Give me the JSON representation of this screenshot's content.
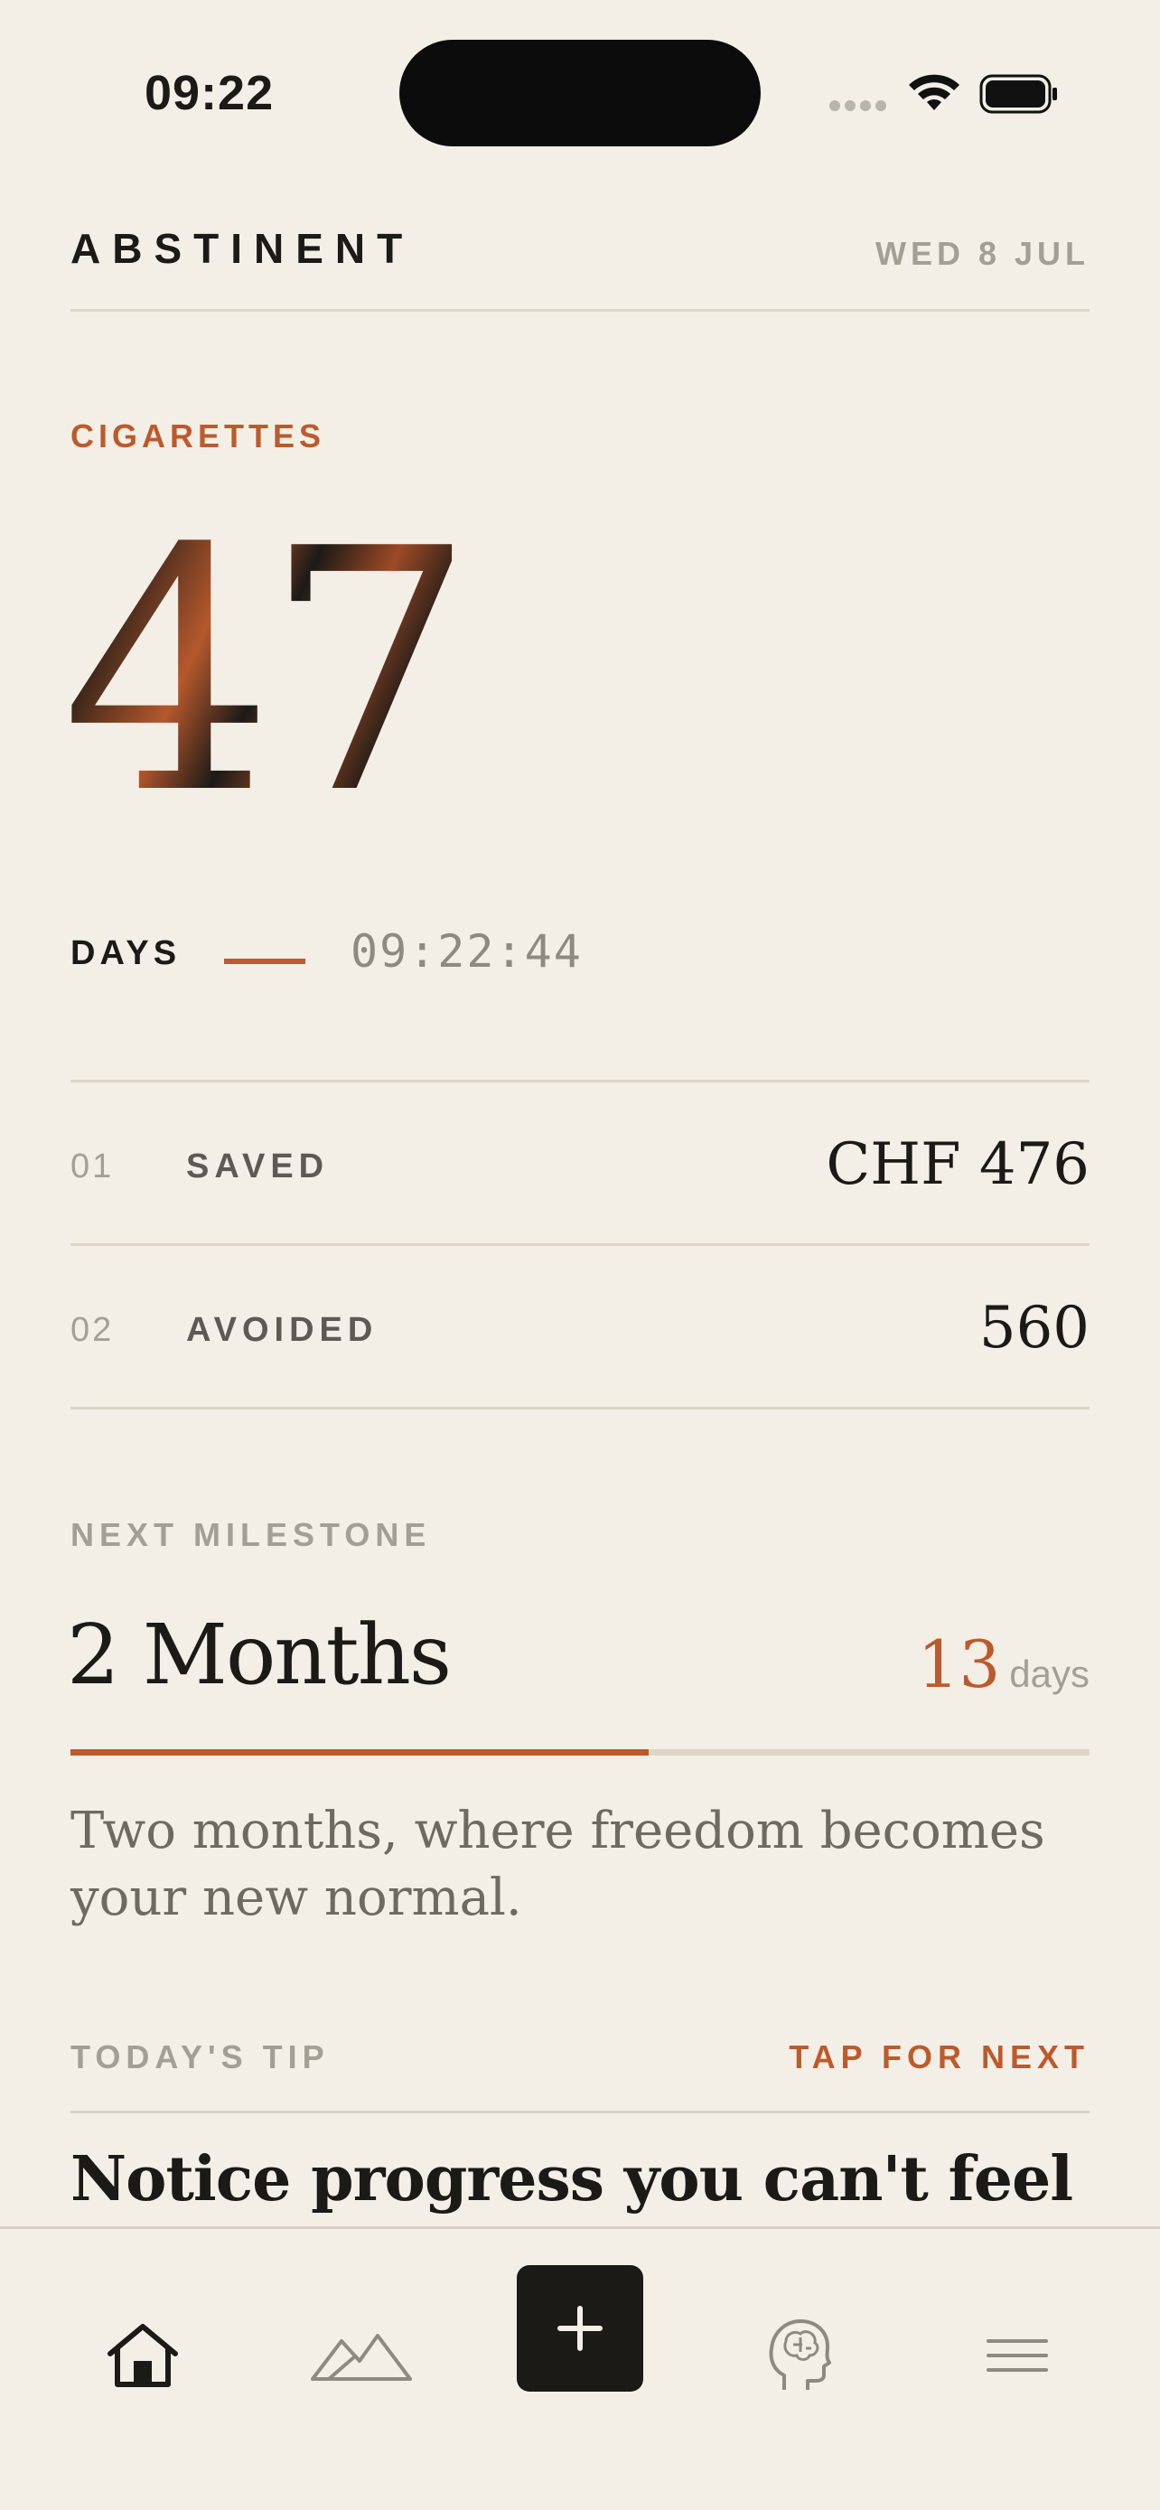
{
  "status_bar": {
    "time": "09:22"
  },
  "header": {
    "app_title": "ABSTINENT",
    "date": "WED 8 JUL"
  },
  "tracker": {
    "category": "CIGARETTES",
    "days_count": "47",
    "days_label": "DAYS",
    "timer": "09:22:44"
  },
  "stats": [
    {
      "index": "01",
      "label": "SAVED",
      "value": "CHF 476"
    },
    {
      "index": "02",
      "label": "AVOIDED",
      "value": "560"
    }
  ],
  "milestone": {
    "label": "NEXT MILESTONE",
    "title": "2 Months",
    "days_remaining": "13",
    "days_unit": "days",
    "progress_fraction": 0.567,
    "description": "Two months, where freedom becomes your new normal."
  },
  "tip": {
    "label": "TODAY'S TIP",
    "next_label": "TAP FOR NEXT",
    "headline": "Notice progress you can't feel"
  },
  "tab_bar": {
    "items": [
      {
        "name": "home",
        "icon": "home-icon"
      },
      {
        "name": "milestones",
        "icon": "mountains-icon"
      },
      {
        "name": "add",
        "icon": "plus-icon"
      },
      {
        "name": "mind",
        "icon": "brain-head-icon"
      },
      {
        "name": "menu",
        "icon": "menu-icon"
      }
    ]
  },
  "colors": {
    "background": "#f3efe6",
    "accent": "#bd5a2c",
    "ink": "#1c1a17",
    "muted": "#a39f95",
    "rule": "#dcd6c8"
  }
}
